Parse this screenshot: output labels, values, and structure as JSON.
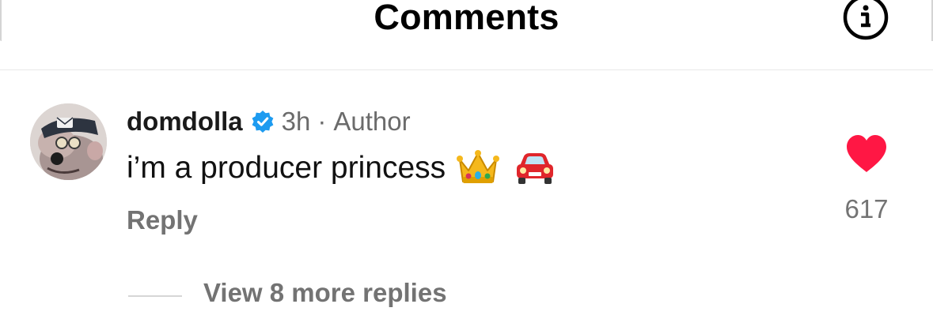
{
  "header": {
    "title": "Comments",
    "info_icon": "info-icon"
  },
  "comment": {
    "username": "domdolla",
    "verified_icon": "verified-badge-icon",
    "time": "3h",
    "separator": "·",
    "author_label": "Author",
    "text": "i’m a producer princess",
    "emojis": [
      "crown-emoji",
      "car-emoji"
    ],
    "reply_label": "Reply",
    "like_icon": "heart-icon",
    "like_count": "617",
    "liked": true
  },
  "replies": {
    "view_more_label": "View 8 more replies"
  },
  "colors": {
    "heart": "#ff1744",
    "verified": "#1d9bf0",
    "muted": "#737373"
  }
}
